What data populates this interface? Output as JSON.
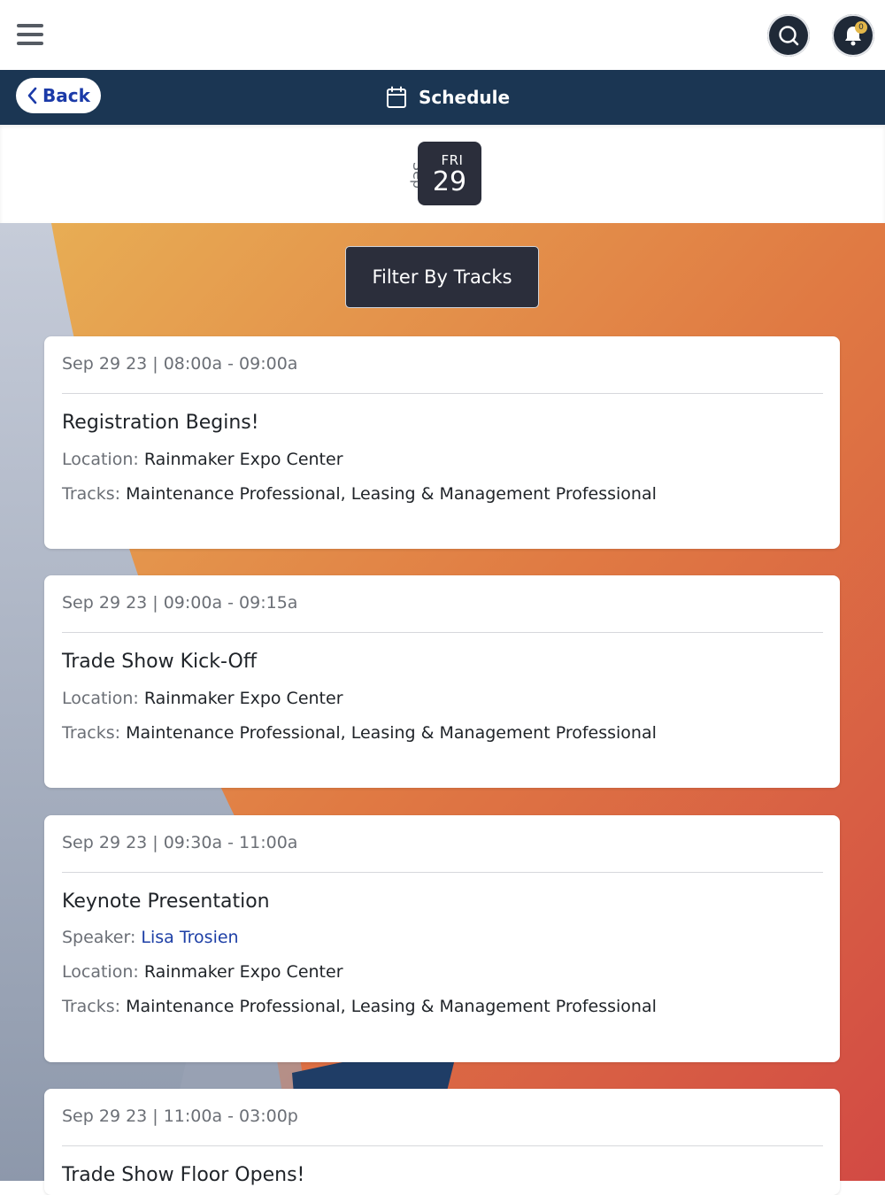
{
  "header": {
    "menu_icon": "hamburger-icon",
    "search_icon": "search-icon",
    "notifications_icon": "bell-icon",
    "notification_count": "0"
  },
  "navbar": {
    "back_label": "Back",
    "title": "Schedule",
    "back_icon": "chevron-left-icon",
    "title_icon": "calendar-icon"
  },
  "date": {
    "month": "Sep",
    "weekday": "FRI",
    "day": "29"
  },
  "filter": {
    "label": "Filter By Tracks"
  },
  "labels": {
    "location": "Location:",
    "tracks": "Tracks:",
    "speaker": "Speaker:"
  },
  "events": [
    {
      "when": "Sep 29 23 | 08:00a - 09:00a",
      "title": "Registration Begins!",
      "location": "Rainmaker Expo Center",
      "tracks": "Maintenance Professional, Leasing & Management Professional"
    },
    {
      "when": "Sep 29 23 | 09:00a - 09:15a",
      "title": "Trade Show Kick-Off",
      "location": "Rainmaker Expo Center",
      "tracks": "Maintenance Professional, Leasing & Management Professional"
    },
    {
      "when": "Sep 29 23 | 09:30a - 11:00a",
      "title": "Keynote Presentation",
      "speaker": "Lisa Trosien",
      "location": "Rainmaker Expo Center",
      "tracks": "Maintenance Professional, Leasing & Management Professional"
    },
    {
      "when": "Sep 29 23 | 11:00a - 03:00p",
      "title": "Trade Show Floor Opens!"
    }
  ],
  "colors": {
    "navbar_bg": "#1b3653",
    "date_tile_bg": "#2b2e3b",
    "link": "#1d3fa6",
    "accent_badge": "#e3b74a"
  }
}
